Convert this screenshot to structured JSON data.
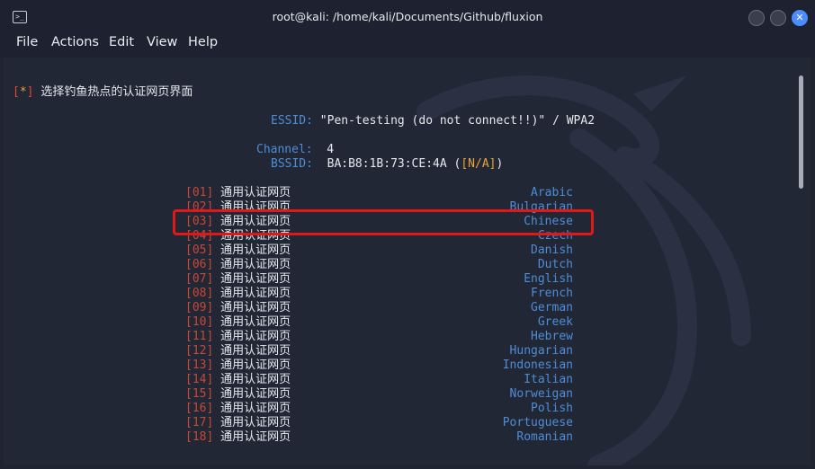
{
  "window": {
    "title": "root@kali: /home/kali/Documents/Github/fluxion",
    "minimize_label": "",
    "maximize_label": "",
    "close_label": "✕"
  },
  "menu": [
    "File",
    "Actions",
    "Edit",
    "View",
    "Help"
  ],
  "terminal": {
    "prompt_marker": "*",
    "heading": "选择钓鱼热点的认证网页界面",
    "essid_label": "ESSID:",
    "essid_value": "\"Pen-testing (do not connect!!)\" / WPA2",
    "channel_label": "Channel:",
    "channel_value": "4",
    "bssid_label": "BSSID:",
    "bssid_value": "BA:B8:1B:73:CE:4A",
    "bssid_vendor": "N/A",
    "options": [
      {
        "num": "01",
        "text": "通用认证网页",
        "lang": "Arabic"
      },
      {
        "num": "02",
        "text": "通用认证网页",
        "lang": "Bulgarian"
      },
      {
        "num": "03",
        "text": "通用认证网页",
        "lang": "Chinese"
      },
      {
        "num": "04",
        "text": "通用认证网页",
        "lang": "Czech"
      },
      {
        "num": "05",
        "text": "通用认证网页",
        "lang": "Danish"
      },
      {
        "num": "06",
        "text": "通用认证网页",
        "lang": "Dutch"
      },
      {
        "num": "07",
        "text": "通用认证网页",
        "lang": "English"
      },
      {
        "num": "08",
        "text": "通用认证网页",
        "lang": "French"
      },
      {
        "num": "09",
        "text": "通用认证网页",
        "lang": "German"
      },
      {
        "num": "10",
        "text": "通用认证网页",
        "lang": "Greek"
      },
      {
        "num": "11",
        "text": "通用认证网页",
        "lang": "Hebrew"
      },
      {
        "num": "12",
        "text": "通用认证网页",
        "lang": "Hungarian"
      },
      {
        "num": "13",
        "text": "通用认证网页",
        "lang": "Indonesian"
      },
      {
        "num": "14",
        "text": "通用认证网页",
        "lang": "Italian"
      },
      {
        "num": "15",
        "text": "通用认证网页",
        "lang": "Norweigan"
      },
      {
        "num": "16",
        "text": "通用认证网页",
        "lang": "Polish"
      },
      {
        "num": "17",
        "text": "通用认证网页",
        "lang": "Portuguese"
      },
      {
        "num": "18",
        "text": "通用认证网页",
        "lang": "Romanian"
      }
    ],
    "highlighted_option": "03"
  },
  "colors": {
    "background": "#222735",
    "marker_red": "#e0482f",
    "accent_yellow": "#e8a33a",
    "label_blue": "#4d8dd6",
    "highlight_box": "#e01818"
  }
}
